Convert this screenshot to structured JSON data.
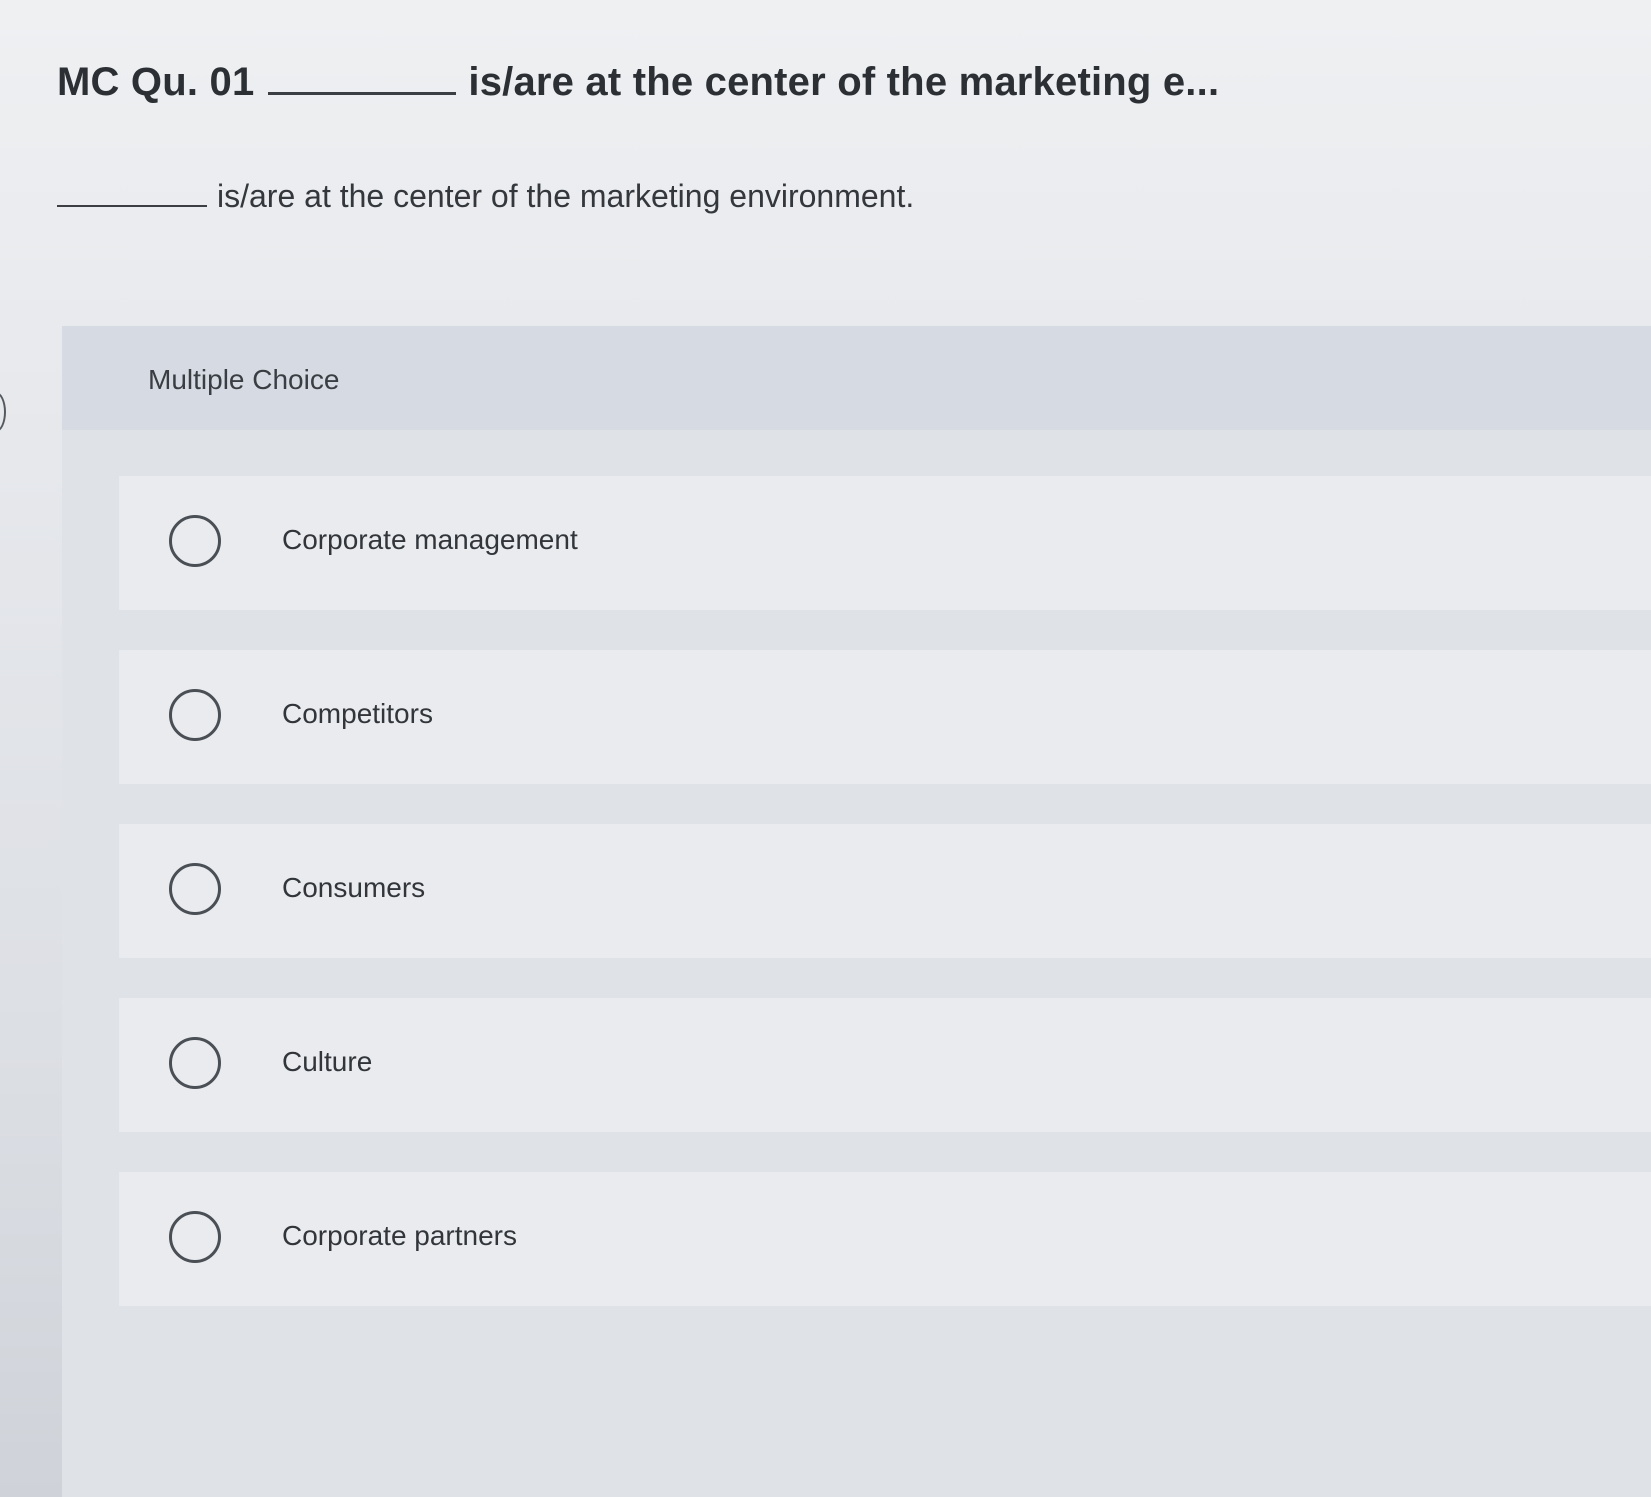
{
  "question": {
    "title_prefix": "MC Qu. 01",
    "title_suffix": "is/are at the center of the marketing e...",
    "stem_text": "is/are at the center of the marketing environment."
  },
  "multiple_choice": {
    "header_label": "Multiple Choice",
    "options": [
      {
        "label": "Corporate management",
        "selected": false
      },
      {
        "label": "Competitors",
        "selected": false
      },
      {
        "label": "Consumers",
        "selected": false
      },
      {
        "label": "Culture",
        "selected": false
      },
      {
        "label": "Corporate partners",
        "selected": false
      }
    ]
  }
}
